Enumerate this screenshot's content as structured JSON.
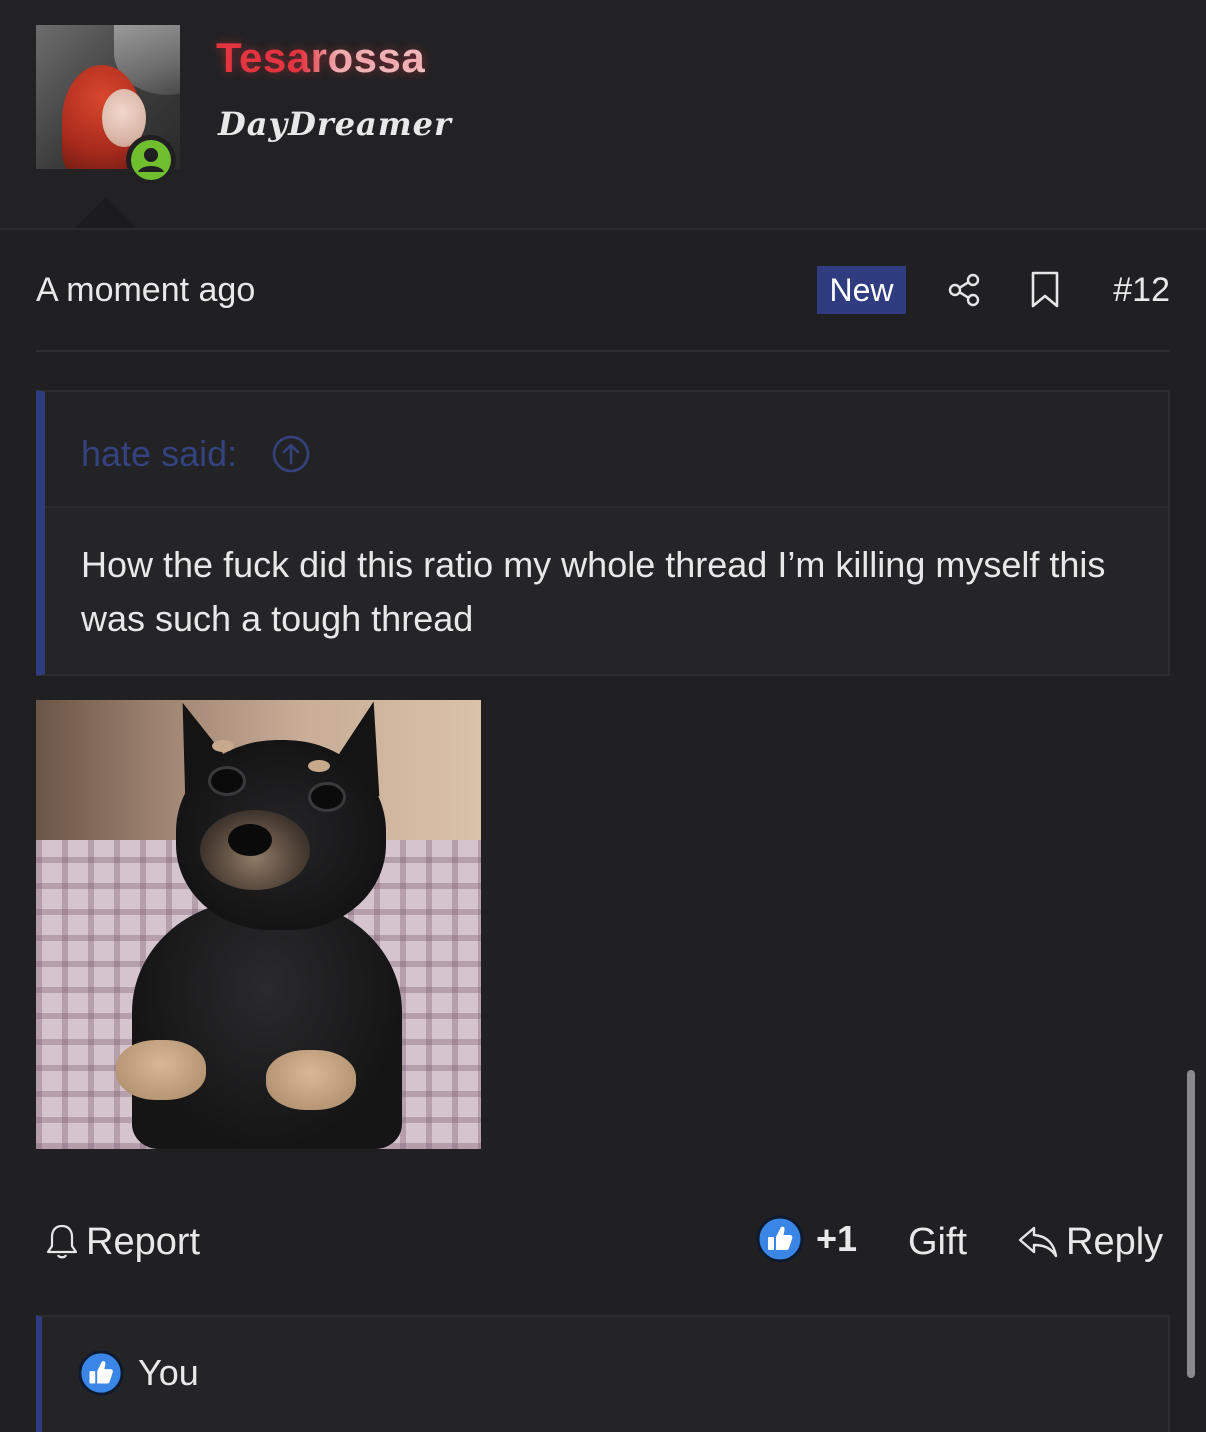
{
  "user": {
    "name": "Tesarossa",
    "title": "DayDreamer",
    "status": "online"
  },
  "post": {
    "time": "A moment ago",
    "badge": "New",
    "number": "#12"
  },
  "quote": {
    "author_label": "hate said:",
    "text": "How the fuck did this ratio my whole thread I’m killing myself this was such a tough thread"
  },
  "actions": {
    "report_label": "Report",
    "like_count": "+1",
    "gift_label": "Gift",
    "reply_label": "Reply"
  },
  "reactions": {
    "entries": [
      {
        "name": "You"
      }
    ]
  },
  "icons": {
    "online": "user-circle-icon",
    "share": "share-icon",
    "bookmark": "bookmark-icon",
    "quote_jump": "arrow-up-circle-icon",
    "report": "bell-icon",
    "like": "thumbs-up-icon",
    "reply": "reply-arrow-icon"
  },
  "colors": {
    "background": "#202022",
    "accent": "#2f3c80",
    "username": "#e4343f",
    "online": "#6fbf2e",
    "like": "#3a86e6"
  }
}
